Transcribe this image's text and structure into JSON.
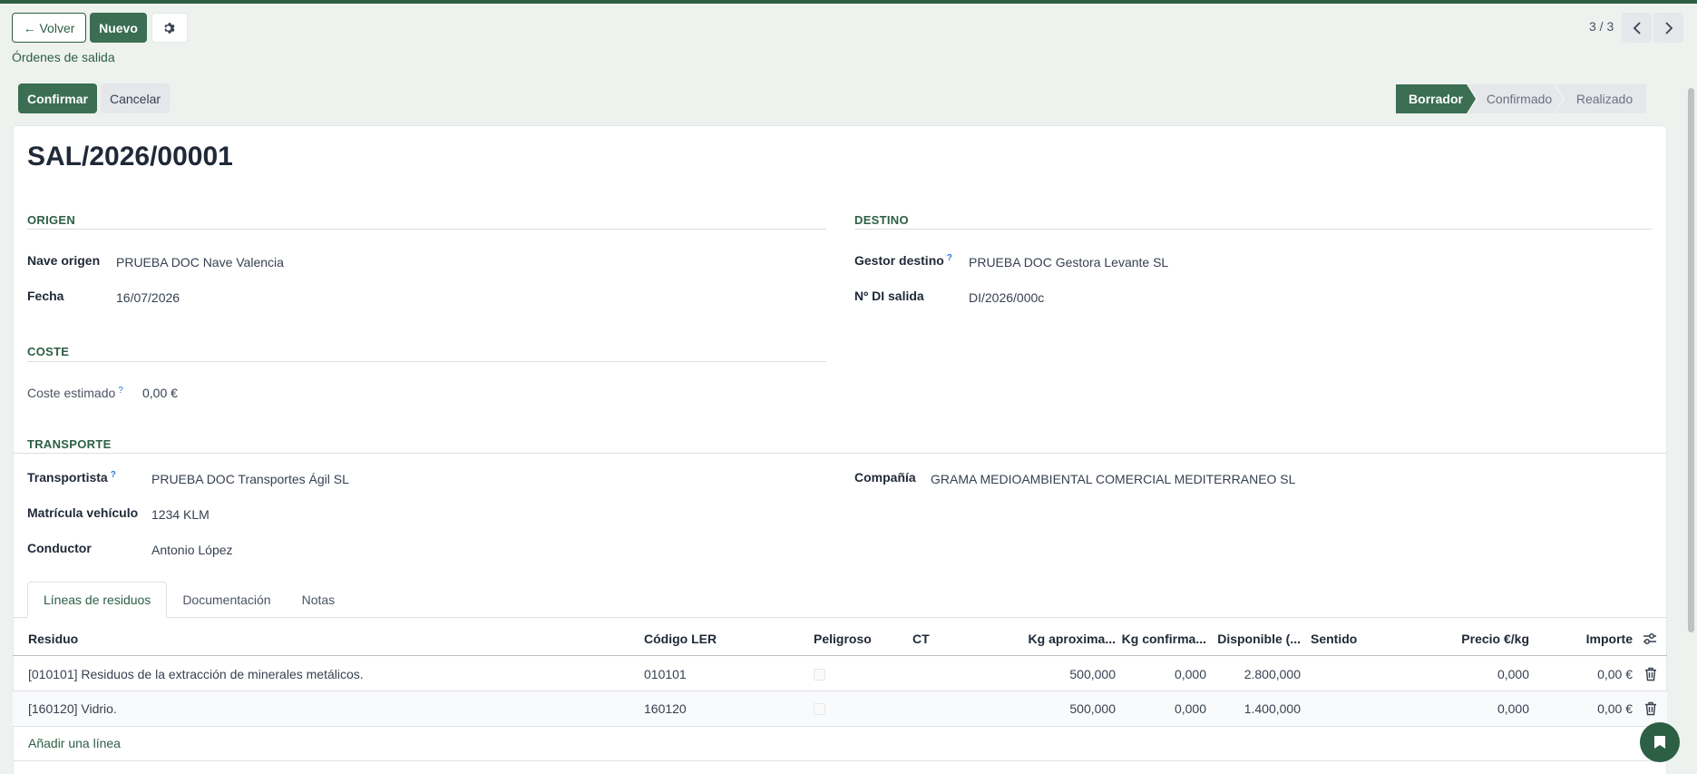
{
  "controls": {
    "back_label": "← Volver",
    "new_label": "Nuevo",
    "breadcrumb": "Órdenes de salida",
    "pager": "3 / 3"
  },
  "actions": {
    "confirm_label": "Confirmar",
    "cancel_label": "Cancelar"
  },
  "status": {
    "stages": [
      "Borrador",
      "Confirmado",
      "Realizado"
    ],
    "active": "Borrador"
  },
  "record": {
    "title": "SAL/2026/00001",
    "origin": {
      "header": "ORIGEN",
      "nave_label": "Nave origen",
      "nave_value": "PRUEBA DOC Nave Valencia",
      "fecha_label": "Fecha",
      "fecha_value": "16/07/2026"
    },
    "dest": {
      "header": "DESTINO",
      "gestor_label": "Gestor destino",
      "gestor_value": "PRUEBA DOC Gestora Levante SL",
      "di_label": "Nº DI salida",
      "di_value": "DI/2026/000c"
    },
    "cost": {
      "header": "COSTE",
      "label": "Coste estimado",
      "value": "0,00 €"
    },
    "transport": {
      "header": "TRANSPORTE",
      "carrier_label": "Transportista",
      "carrier_value": "PRUEBA DOC Transportes Ágil SL",
      "plate_label": "Matrícula vehículo",
      "plate_value": "1234 KLM",
      "driver_label": "Conductor",
      "driver_value": "Antonio López",
      "company_label": "Compañía",
      "company_value": "GRAMA MEDIOAMBIENTAL COMERCIAL MEDITERRANEO SL"
    }
  },
  "tabs": [
    "Líneas de residuos",
    "Documentación",
    "Notas"
  ],
  "table": {
    "columns": [
      "Residuo",
      "Código LER",
      "Peligroso",
      "CT",
      "Kg aproxima...",
      "Kg confirma...",
      "Disponible (...",
      "Sentido",
      "Precio €/kg",
      "Importe"
    ],
    "rows": [
      {
        "residuo": "[010101] Residuos de la extracción de minerales metálicos.",
        "ler": "010101",
        "kg_aprox": "500,000",
        "kg_conf": "0,000",
        "disponible": "2.800,000",
        "precio": "0,000",
        "importe": "0,00 €"
      },
      {
        "residuo": "[160120] Vidrio.",
        "ler": "160120",
        "kg_aprox": "500,000",
        "kg_conf": "0,000",
        "disponible": "1.400,000",
        "precio": "0,000",
        "importe": "0,00 €"
      }
    ],
    "add_line": "Añadir una línea"
  },
  "colors": {
    "primary": "#3b6e52",
    "dark": "#2d5f45",
    "help": "#2d7ad6"
  },
  "icons": [
    "gear-icon",
    "chevron-left-icon",
    "chevron-right-icon",
    "help-icon",
    "trash-icon",
    "settings-sliders-icon",
    "chat-icon"
  ]
}
